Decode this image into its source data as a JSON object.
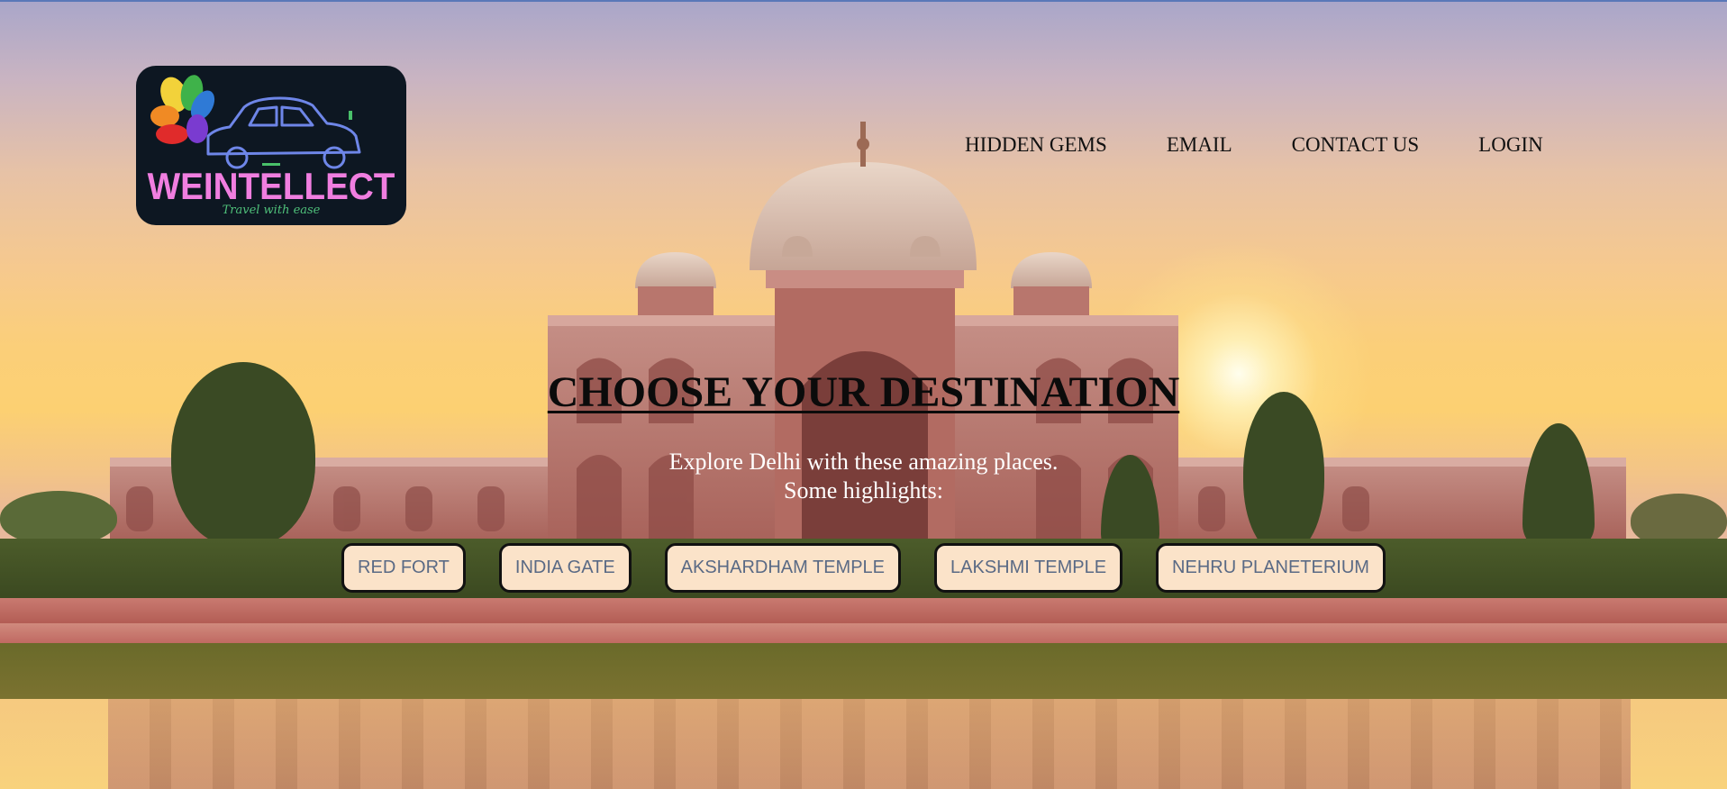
{
  "logo": {
    "brand": "WEINTELLECT",
    "tagline": "Travel with ease"
  },
  "nav": {
    "items": [
      "HIDDEN GEMS",
      "EMAIL",
      "CONTACT US",
      "LOGIN"
    ]
  },
  "hero": {
    "title": "CHOOSE YOUR DESTINATION",
    "subtitle_line1": "Explore Delhi with these amazing places.",
    "subtitle_line2": "Some highlights:"
  },
  "destinations": [
    "RED FORT",
    "INDIA GATE",
    "AKSHARDHAM TEMPLE",
    "LAKSHMI TEMPLE",
    "NEHRU PLANETERIUM"
  ],
  "colors": {
    "logo_bg": "#0d1722",
    "logo_text": "#f07ee0",
    "button_bg": "#fbe3c9",
    "button_text": "#5a6a85",
    "title_text": "#0b0b0b"
  }
}
